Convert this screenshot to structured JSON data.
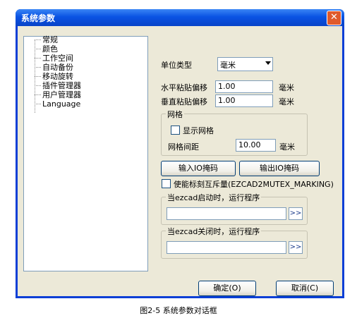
{
  "window": {
    "title": "系统参数",
    "close_label": "✕"
  },
  "tree": {
    "items": [
      "常规",
      "颜色",
      "工作空间",
      "自动备份",
      "移动旋转",
      "插件管理器",
      "用户管理器",
      "Language"
    ]
  },
  "settings": {
    "unit_type_label": "单位类型",
    "unit_type_value": "毫米",
    "h_offset_label": "水平粘贴偏移",
    "h_offset_value": "1.00",
    "h_offset_unit": "毫米",
    "v_offset_label": "垂直粘贴偏移",
    "v_offset_value": "1.00",
    "v_offset_unit": "毫米"
  },
  "grid": {
    "group_title": "网格",
    "show_label": "显示网格",
    "spacing_label": "网格间距",
    "spacing_value": "10.00",
    "spacing_unit": "毫米"
  },
  "io": {
    "input_mask_label": "输入IO掩码",
    "output_mask_label": "输出IO掩码"
  },
  "mutex": {
    "label": "使能标刻互斥量(EZCAD2MUTEX_MARKING)"
  },
  "startup": {
    "group_title": "当ezcad启动时，运行程序",
    "value": "",
    "browse_label": ">>"
  },
  "shutdown": {
    "group_title": "当ezcad关闭时，运行程序",
    "value": "",
    "browse_label": ">>"
  },
  "footer": {
    "ok_label": "确定(O)",
    "cancel_label": "取消(C)"
  },
  "caption": "图2-5 系统参数对话框"
}
